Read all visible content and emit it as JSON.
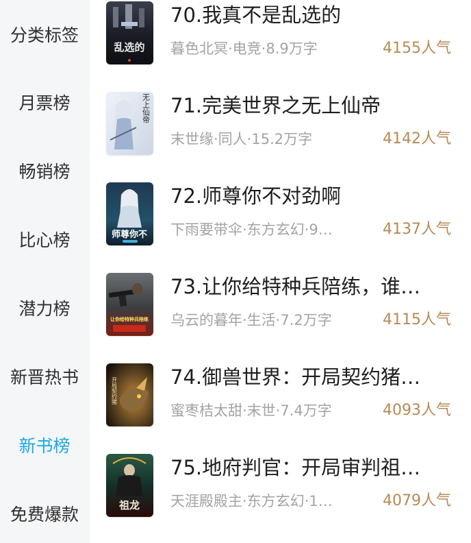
{
  "sidebar": {
    "items": [
      {
        "label": "分类标签",
        "active": false
      },
      {
        "label": "月票榜",
        "active": false
      },
      {
        "label": "畅销榜",
        "active": false
      },
      {
        "label": "比心榜",
        "active": false
      },
      {
        "label": "潜力榜",
        "active": false
      },
      {
        "label": "新晋热书",
        "active": false
      },
      {
        "label": "新书榜",
        "active": true
      },
      {
        "label": "免费爆款",
        "active": false
      }
    ],
    "active_color": "#17a9e6"
  },
  "books": [
    {
      "title": "70.我真不是乱选的",
      "meta": "暮色北冥·电竞·8.9万字",
      "popularity": "4155人气",
      "cover_text": "乱选的"
    },
    {
      "title": "71.完美世界之无上仙帝",
      "meta": "末世缘·同人·15.2万字",
      "popularity": "4142人气",
      "cover_text": "无上仙帝"
    },
    {
      "title": "72.师尊你不对劲啊",
      "meta": "下雨要带伞·东方玄幻·9…",
      "popularity": "4137人气",
      "cover_text": "师尊你不"
    },
    {
      "title": "73.让你给特种兵陪练，谁…",
      "meta": "乌云的暮年·生活·7.2万字",
      "popularity": "4115人气",
      "cover_text": "让你给特种兵陪练"
    },
    {
      "title": "74.御兽世界：开局契约猪…",
      "meta": "蜜枣桔太甜·末世·7.4万字",
      "popularity": "4093人气",
      "cover_text": "开局契约猪"
    },
    {
      "title": "75.地府判官：开局审判祖…",
      "meta": "天涯殿殿主·东方玄幻·1…",
      "popularity": "4079人气",
      "cover_text": "祖龙"
    }
  ],
  "colors": {
    "sidebar_bg": "#f5f6f8",
    "popularity": "#b78a54",
    "meta": "#a3a3a3"
  }
}
